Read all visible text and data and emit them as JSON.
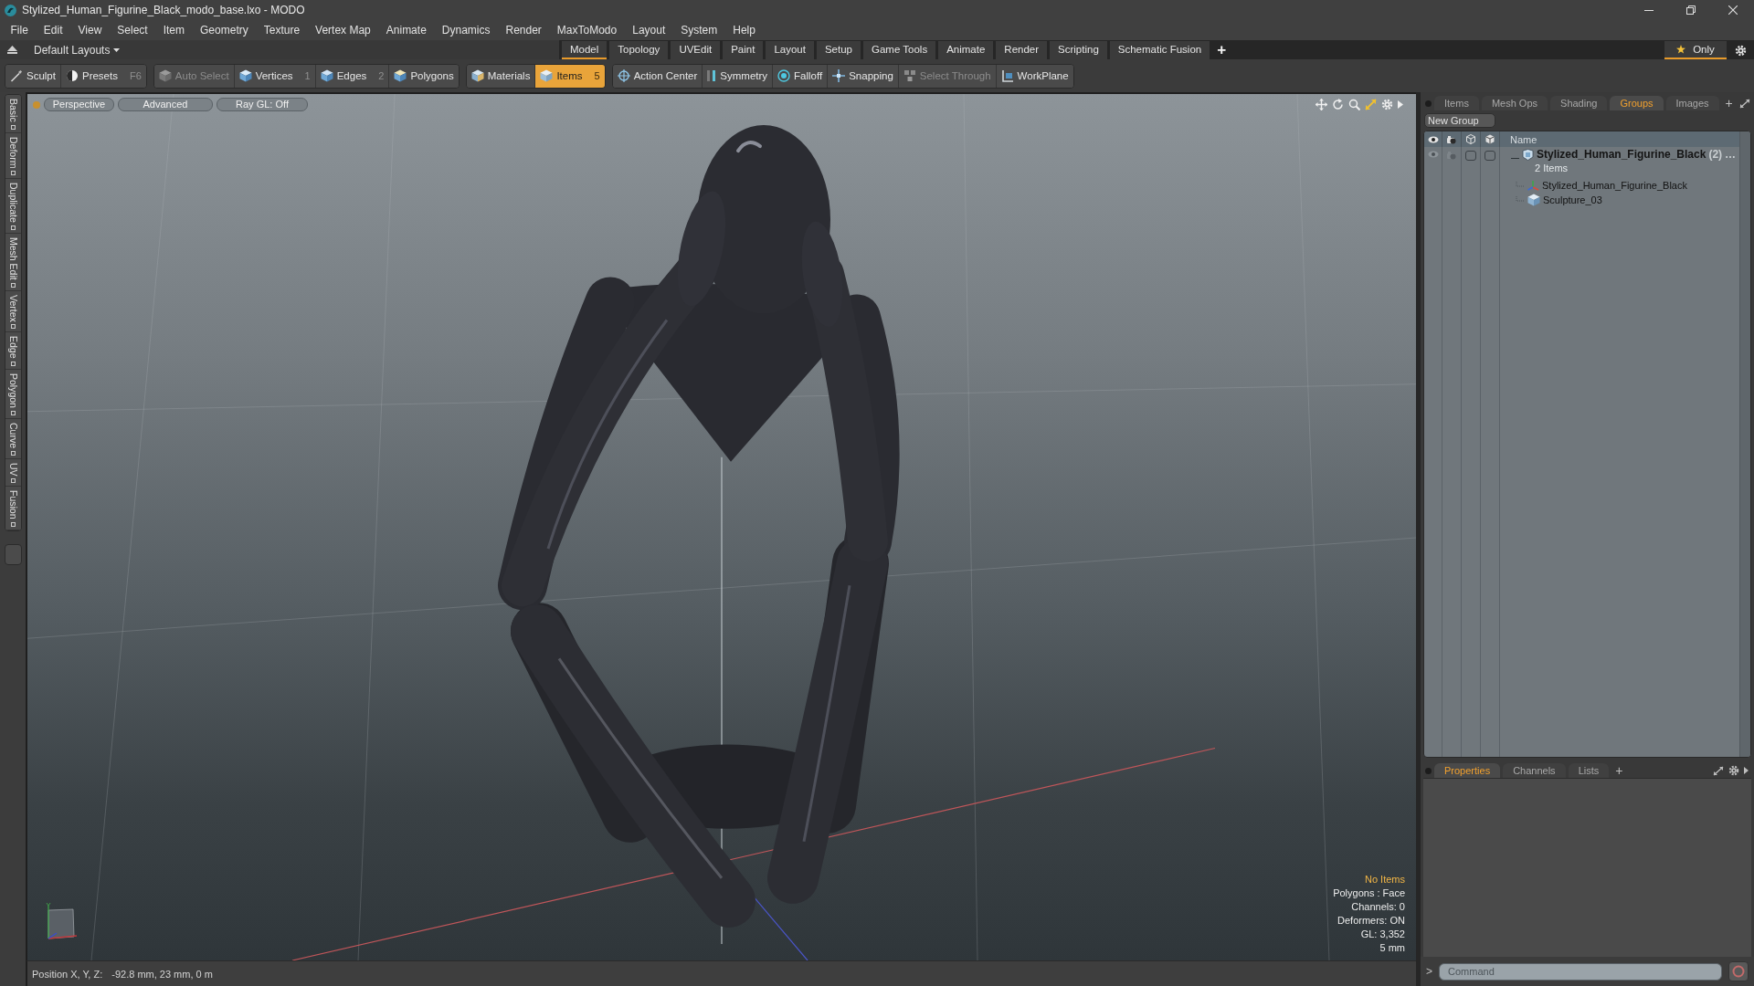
{
  "window": {
    "title": "Stylized_Human_Figurine_Black_modo_base.lxo - MODO"
  },
  "menu": [
    "File",
    "Edit",
    "View",
    "Select",
    "Item",
    "Geometry",
    "Texture",
    "Vertex Map",
    "Animate",
    "Dynamics",
    "Render",
    "MaxToModo",
    "Layout",
    "System",
    "Help"
  ],
  "layout_bar": {
    "layouts": "Default Layouts",
    "tabs": [
      {
        "label": "Model",
        "selected": true
      },
      {
        "label": "Topology",
        "selected": false
      },
      {
        "label": "UVEdit",
        "selected": false
      },
      {
        "label": "Paint",
        "selected": false
      },
      {
        "label": "Layout",
        "selected": false
      },
      {
        "label": "Setup",
        "selected": false
      },
      {
        "label": "Game Tools",
        "selected": false
      },
      {
        "label": "Animate",
        "selected": false
      },
      {
        "label": "Render",
        "selected": false
      },
      {
        "label": "Scripting",
        "selected": false
      },
      {
        "label": "Schematic Fusion",
        "selected": false
      }
    ],
    "add_tab": "+",
    "only": {
      "label": "Only",
      "on": true
    }
  },
  "toolbar": [
    {
      "tools": [
        {
          "label": "Sculpt",
          "selected": false,
          "disabled": false
        },
        {
          "label": "Presets",
          "shortcut": "F6",
          "selected": false,
          "disabled": false
        }
      ]
    },
    {
      "tools": [
        {
          "label": "Auto Select",
          "selected": false,
          "disabled": true
        },
        {
          "label": "Vertices",
          "shortcut": "1",
          "selected": false,
          "disabled": false
        },
        {
          "label": "Edges",
          "shortcut": "2",
          "selected": false,
          "disabled": false
        },
        {
          "label": "Polygons",
          "selected": false,
          "disabled": false
        }
      ]
    },
    {
      "tools": [
        {
          "label": "Materials",
          "selected": false,
          "disabled": false
        },
        {
          "label": "Items",
          "shortcut": "5",
          "selected": true,
          "disabled": false
        }
      ]
    },
    {
      "tools": [
        {
          "label": "Action Center",
          "selected": false,
          "disabled": false
        },
        {
          "label": "Symmetry",
          "selected": false,
          "disabled": false
        },
        {
          "label": "Falloff",
          "selected": false,
          "disabled": false
        },
        {
          "label": "Snapping",
          "selected": false,
          "disabled": false
        },
        {
          "label": "Select Through",
          "selected": false,
          "disabled": true
        },
        {
          "label": "WorkPlane",
          "selected": false,
          "disabled": false
        }
      ]
    }
  ],
  "side_tabs": [
    "Basic",
    "Deform",
    "Duplicate",
    "Mesh Edit",
    "Vertex",
    "Edge",
    "Polygon",
    "Curve",
    "UV",
    "Fusion"
  ],
  "viewport": {
    "view_buttons": [
      "Perspective",
      "Advanced",
      "Ray GL: Off"
    ],
    "info": [
      {
        "text": "No Items",
        "kind": "highlight"
      },
      {
        "text": "Polygons : Face",
        "kind": "plain"
      },
      {
        "text": "Channels: 0",
        "kind": "plain"
      },
      {
        "text": "Deformers: ON",
        "kind": "plain"
      },
      {
        "text": "GL: 3,352",
        "kind": "plain"
      },
      {
        "text": "5 mm",
        "kind": "plain"
      }
    ]
  },
  "status_bar": {
    "label": "Position X, Y, Z:",
    "value": "-92.8 mm, 23 mm, 0 m"
  },
  "groups_panel": {
    "tabs": [
      {
        "label": "Items",
        "selected": false
      },
      {
        "label": "Mesh Ops",
        "selected": false
      },
      {
        "label": "Shading",
        "selected": false
      },
      {
        "label": "Groups",
        "selected": true
      },
      {
        "label": "Images",
        "selected": false
      }
    ],
    "add_tab": "+",
    "new_group": "New Group",
    "name_column": "Name",
    "tree": [
      {
        "name": "Stylized_Human_Figurine_Black",
        "count": "(2)",
        "more": "…",
        "subtitle": "2 Items",
        "kind": "group",
        "expanded": true,
        "children": [
          {
            "name": "Stylized_Human_Figurine_Black",
            "kind": "locator"
          },
          {
            "name": "Sculpture_03",
            "kind": "mesh"
          }
        ]
      }
    ]
  },
  "properties_panel": {
    "tabs": [
      {
        "label": "Properties",
        "selected": true
      },
      {
        "label": "Channels",
        "selected": false
      },
      {
        "label": "Lists",
        "selected": false
      }
    ],
    "add_tab": "+",
    "prompt": ">",
    "command": {
      "placeholder": "Command"
    }
  }
}
